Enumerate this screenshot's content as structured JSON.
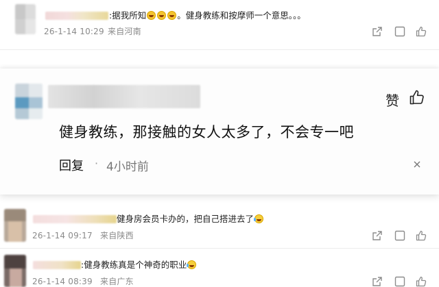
{
  "comments": [
    {
      "text_before": ":据我所知",
      "emojis": [
        "grinning-sweat",
        "grinning-sweat",
        "grinning-sweat"
      ],
      "text_after": "。健身教练和按摩师一个意思。。。",
      "date": "26-1-14 10:29",
      "location": "来自河南"
    },
    {
      "text": "健身房会员卡办的，把自己搭进去了",
      "emoji": "tears-of-joy",
      "date": "26-1-14 09:17",
      "location": "来自陕西"
    },
    {
      "text": ":健身教练真是个神奇的职业",
      "emoji": "tears-of-joy",
      "date": "26-1-14 08:39",
      "location": "来自广东"
    }
  ],
  "highlight": {
    "text": "健身教练，那接触的女人太多了，不会专一吧",
    "like_label": "赞",
    "reply_label": "回复",
    "separator": "·",
    "time_ago": "4小时前"
  },
  "colors": {
    "meta": "#8a8a8a",
    "text": "#1a1a1a",
    "icon": "#8c8c8c"
  }
}
